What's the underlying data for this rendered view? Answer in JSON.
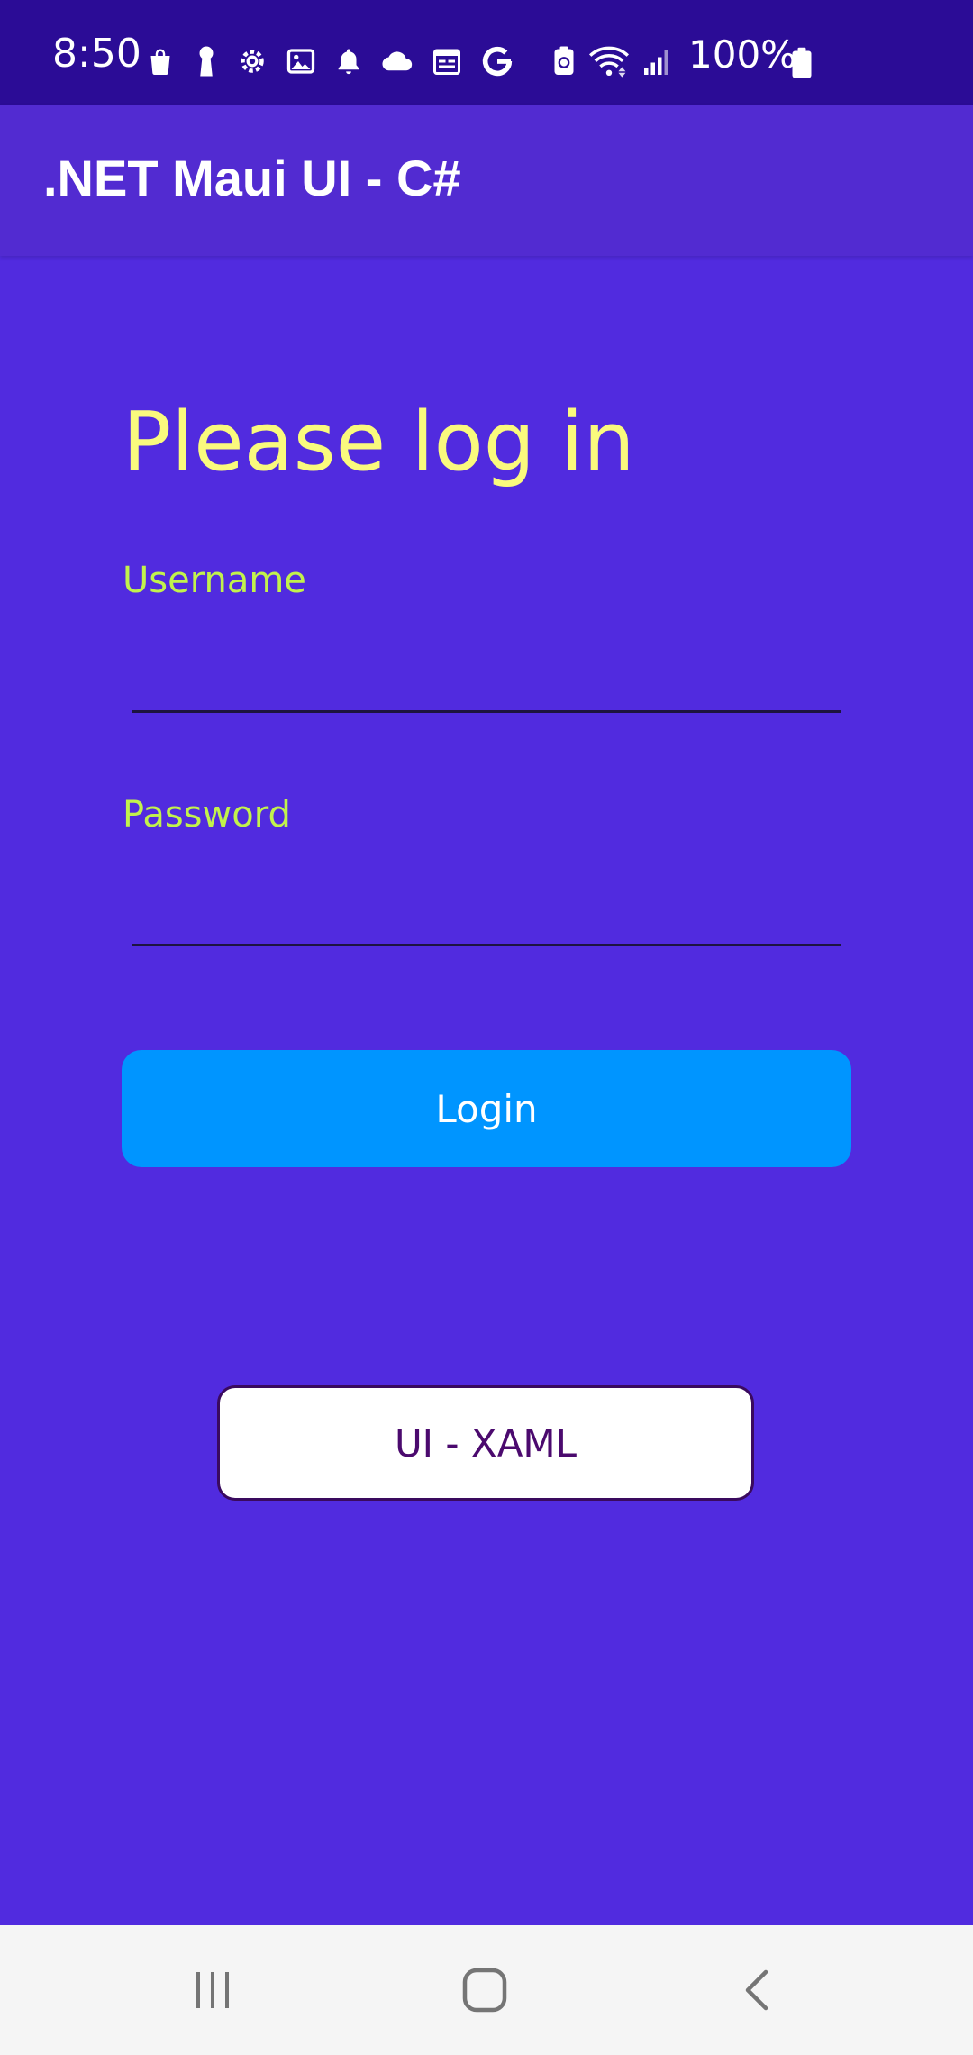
{
  "status_bar": {
    "time": "8:50",
    "battery_percent": "100%",
    "icons": [
      "shopping-bag-icon",
      "keyhole-icon",
      "settings-icon",
      "gallery-icon",
      "notification-bell-icon",
      "cloud-icon",
      "calendar-icon",
      "google-icon",
      "battery-saver-icon",
      "wifi-icon",
      "signal-icon",
      "battery-icon"
    ]
  },
  "app_bar": {
    "title": ".NET Maui UI - C#"
  },
  "login_form": {
    "heading": "Please log in",
    "username_label": "Username",
    "username_value": "",
    "password_label": "Password",
    "password_value": "",
    "login_button": "Login"
  },
  "switch_button": {
    "label": "UI - XAML"
  },
  "nav_bar": {
    "buttons": [
      "recent-apps-icon",
      "home-icon",
      "back-icon"
    ]
  },
  "colors": {
    "background": "#512BDF",
    "status_bar": "#2B0C96",
    "heading": "#FAFA7D",
    "label": "#C2F24C",
    "login_button": "#0095FF"
  }
}
